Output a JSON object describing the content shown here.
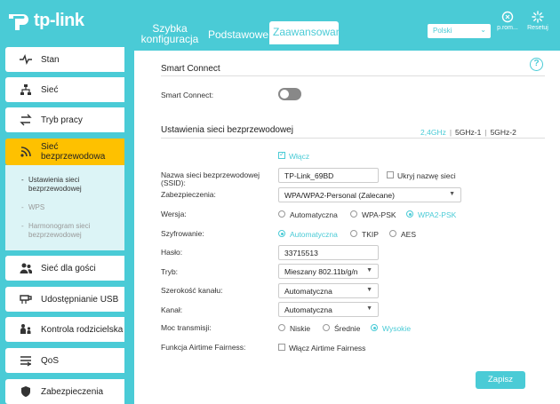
{
  "header": {
    "brand": "tp-link",
    "tabs": [
      {
        "label_line1": "Szybka",
        "label_line2": "konfiguracja"
      },
      {
        "label": "Podstawowe"
      },
      {
        "label": "Zaawansowane"
      }
    ],
    "language": "Polski",
    "logout_label": "p.rom...",
    "reboot_label": "Resetuj"
  },
  "sidebar": {
    "items": [
      {
        "label": "Stan",
        "icon": "pulse-icon"
      },
      {
        "label": "Sieć",
        "icon": "network-icon"
      },
      {
        "label": "Tryb pracy",
        "icon": "mode-icon"
      },
      {
        "label": "Sieć bezprzewodowa",
        "icon": "wifi-icon"
      },
      {
        "label": "Sieć dla gości",
        "icon": "guest-icon"
      },
      {
        "label": "Udostępnianie USB",
        "icon": "usb-icon"
      },
      {
        "label": "Kontrola rodzicielska",
        "icon": "parental-icon"
      },
      {
        "label": "QoS",
        "icon": "qos-icon"
      },
      {
        "label": "Zabezpieczenia",
        "icon": "shield-icon"
      }
    ],
    "submenu": [
      {
        "label_line1": "Ustawienia sieci",
        "label_line2": "bezprzewodowej"
      },
      {
        "label": "WPS"
      },
      {
        "label_line1": "Harmonogram sieci",
        "label_line2": "bezprzewodowej"
      }
    ]
  },
  "smart_connect": {
    "title": "Smart Connect",
    "label": "Smart Connect:"
  },
  "wireless": {
    "title": "Ustawienia sieci bezprzewodowej",
    "bands": [
      "2,4GHz",
      "5GHz-1",
      "5GHz-2"
    ],
    "enable_label": "Włącz",
    "ssid_label_line1": "Nazwa sieci bezprzewodowej",
    "ssid_label_line2": "(SSID):",
    "ssid_value": "TP-Link_69BD",
    "hide_ssid_label": "Ukryj nazwę sieci",
    "security_label": "Zabezpieczenia:",
    "security_value": "WPA/WPA2-Personal (Zalecane)",
    "version_label": "Wersja:",
    "version_options": [
      "Automatyczna",
      "WPA-PSK",
      "WPA2-PSK"
    ],
    "encryption_label": "Szyfrowanie:",
    "encryption_options": [
      "Automatyczna",
      "TKIP",
      "AES"
    ],
    "password_label": "Hasło:",
    "password_value": "33715513",
    "mode_label": "Tryb:",
    "mode_value": "Mieszany 802.11b/g/n",
    "width_label": "Szerokość kanału:",
    "width_value": "Automatyczna",
    "channel_label": "Kanał:",
    "channel_value": "Automatyczna",
    "power_label": "Moc transmisji:",
    "power_options": [
      "Niskie",
      "Średnie",
      "Wysokie"
    ],
    "airtime_label": "Funkcja Airtime Fairness:",
    "airtime_option": "Włącz Airtime Fairness"
  },
  "save_label": "Zapisz",
  "help_label": "?",
  "colors": {
    "accent": "#4acbd6",
    "active_menu": "#fec100"
  }
}
